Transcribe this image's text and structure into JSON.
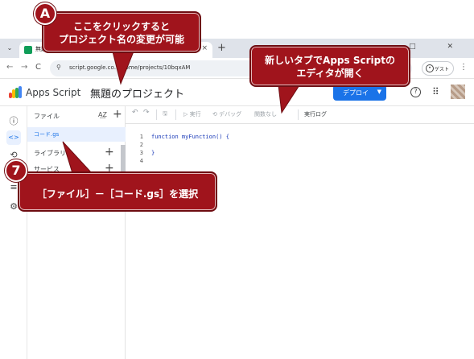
{
  "browser": {
    "tab_title": "無題",
    "tab_close": "×",
    "tab_list": "⌄",
    "new_tab": "+",
    "window_controls": "– □ ✕",
    "back": "←",
    "forward": "→",
    "reload": "C",
    "site_info": "⚲",
    "url": "script.google.co…/home/projects/10bqxAM",
    "guest_label": "ゲスト",
    "menu": "⋮"
  },
  "header": {
    "brand": "Apps Script",
    "project_name": "無題のプロジェクト",
    "deploy_label": "デプロイ",
    "help_icon": "?",
    "apps_icon": "⠿"
  },
  "rail": {
    "icons": [
      "ⓘ",
      "<>",
      "⟲",
      "≡",
      "⚙"
    ]
  },
  "files_pane": {
    "title": "ファイル",
    "sort_icon": "A͢Z",
    "add_icon": "+",
    "file_name": "コード.gs",
    "libraries": "ライブラリ",
    "services": "サービス"
  },
  "toolbar": {
    "undo": "↶",
    "redo": "↷",
    "save": "🖫",
    "run": "▷ 実行",
    "debug": "⟲ デバッグ",
    "function_select": "関数なし",
    "log": "実行ログ"
  },
  "editor": {
    "line_numbers": [
      "1",
      "2",
      "3",
      "4"
    ],
    "lines": [
      "function myFunction() {",
      "",
      "}",
      ""
    ]
  },
  "callouts": {
    "a_badge": "A",
    "a_line1": "ここをクリックすると",
    "a_line2": "プロジェクト名の変更が可能",
    "b_line1": "新しいタブでApps Scriptの",
    "b_line2": "エディタが開く",
    "step_badge": "7",
    "step_text": "［ファイル］－［コード.gs］を選択"
  }
}
